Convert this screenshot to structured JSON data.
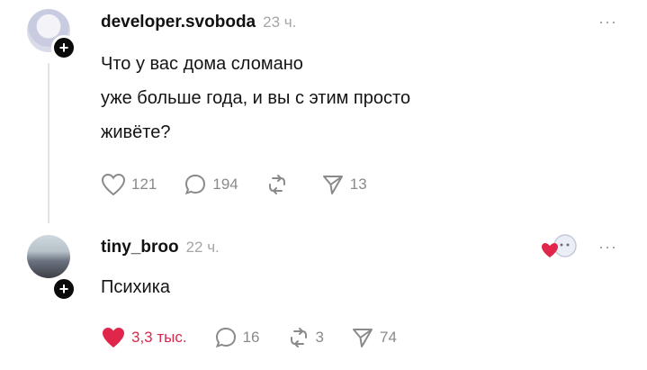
{
  "posts": [
    {
      "username": "developer.svoboda",
      "time": "23 ч.",
      "lines": [
        "Что у вас дома сломано",
        "уже больше года, и вы с этим просто",
        "живёте?"
      ],
      "likes": "121",
      "comments": "194",
      "reposts": "",
      "shares": "13",
      "more": "···"
    },
    {
      "username": "tiny_broo",
      "time": "22 ч.",
      "lines": [
        "Психика"
      ],
      "likes": "3,3 тыс.",
      "comments": "16",
      "reposts": "3",
      "shares": "74",
      "more": "···",
      "liked_color": "#e0264a"
    }
  ],
  "plus_symbol": "+"
}
